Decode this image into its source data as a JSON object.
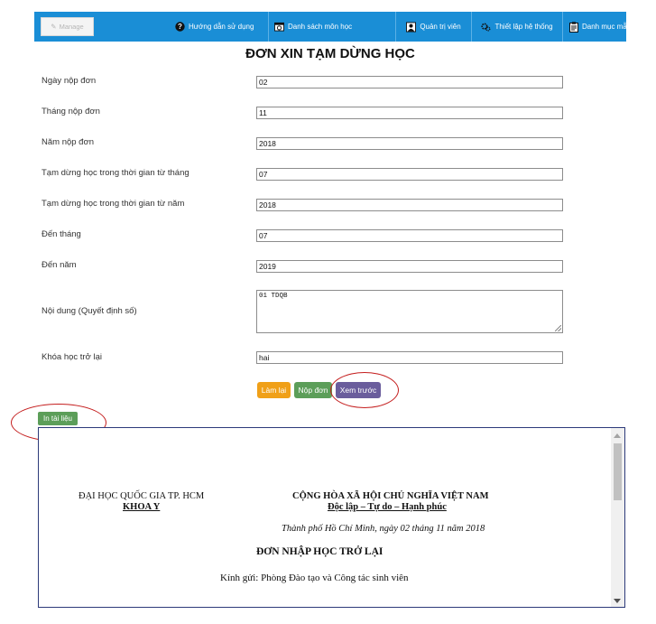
{
  "toolbar": {
    "manage_label": "Manage",
    "nav": [
      {
        "label": "Hướng dẫn sử dụng",
        "icon": "question-circle-icon"
      },
      {
        "label": "Danh sách môn học",
        "icon": "calendar-icon"
      },
      {
        "label": "Quản trị viên",
        "icon": "user-admin-icon"
      },
      {
        "label": "Thiết lập hệ thống",
        "icon": "gears-icon"
      },
      {
        "label": "Danh mục mẫu đơn",
        "icon": "clipboard-icon"
      }
    ]
  },
  "form": {
    "title": "ĐƠN XIN TẠM DỪNG HỌC",
    "fields": [
      {
        "label": "Ngày nộp đơn",
        "value": "02"
      },
      {
        "label": "Tháng nộp đơn",
        "value": "11"
      },
      {
        "label": "Năm nộp đơn",
        "value": "2018"
      },
      {
        "label": "Tạm dừng học trong thời gian từ tháng",
        "value": "07"
      },
      {
        "label": "Tạm dừng học trong thời gian từ năm",
        "value": "2018"
      },
      {
        "label": "Đến tháng",
        "value": "07"
      },
      {
        "label": "Đến năm",
        "value": "2019"
      }
    ],
    "content_label": "Nội dung (Quyết định số)",
    "content_value": "01 TDQB",
    "return_course_label": "Khóa học trở lại",
    "return_course_value": "hai",
    "buttons": {
      "reset": "Làm lại",
      "submit": "Nộp đơn",
      "preview": "Xem trước"
    },
    "print_label": "In tài liệu"
  },
  "document": {
    "university": "ĐẠI HỌC QUỐC GIA TP. HCM",
    "faculty": "KHOA Y",
    "republic": "CỘNG HÒA XÃ HỘI CHỦ NGHĨA VIỆT NAM",
    "motto": "Độc lập – Tự do – Hạnh phúc",
    "date_line": "Thành phố Hồ Chí Minh, ngày 02 tháng 11 năm 2018",
    "doc_title": "ĐƠN NHẬP HỌC TRỞ LẠI",
    "recipient": "Kính gửi: Phòng Đào tạo và Công tác sinh viên"
  },
  "colors": {
    "toolbar": "#1a8ed6",
    "reset": "#f0a018",
    "submit": "#5c9e59",
    "preview": "#6a5d9c",
    "annotation": "#c41d1d"
  }
}
